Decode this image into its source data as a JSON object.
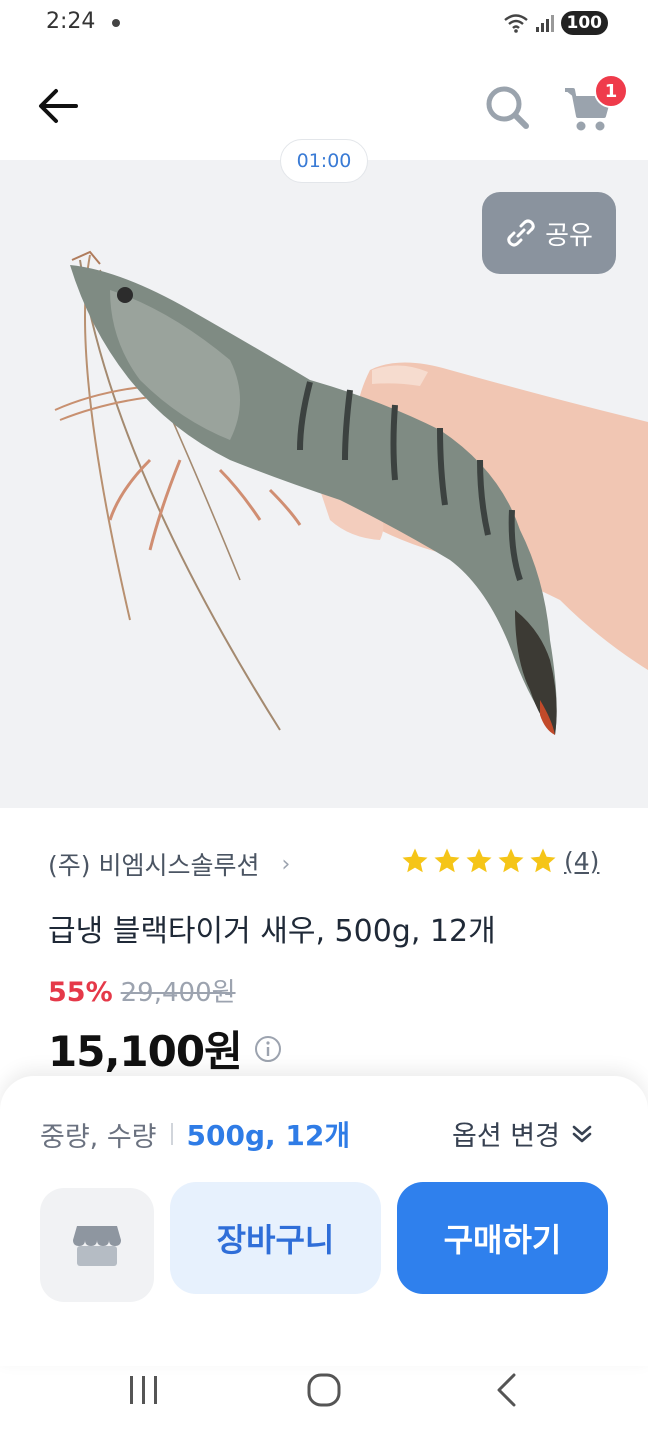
{
  "status": {
    "time": "2:24",
    "battery": "100"
  },
  "nav": {
    "cart_count": "1"
  },
  "media": {
    "timer": "01:00",
    "share_label": "공유"
  },
  "product": {
    "seller": "(주) 비엠시스솔루션",
    "rating_count": "(4)",
    "rating_stars": 5,
    "title": "급냉 블랙타이거 새우, 500g, 12개",
    "discount_rate": "55%",
    "original_price": "29,400원",
    "sale_price": "15,100원"
  },
  "options": {
    "label": "중량, 수량",
    "value": "500g, 12개",
    "change_label": "옵션 변경"
  },
  "actions": {
    "add_to_cart": "장바구니",
    "buy_now": "구매하기"
  },
  "colors": {
    "accent": "#2f80ed",
    "discount": "#e53949",
    "badge": "#ef3b4b",
    "star": "#f5c518"
  },
  "icons": {
    "back": "arrow-left-icon",
    "search": "search-icon",
    "cart": "cart-icon",
    "share": "link-icon",
    "store": "store-icon",
    "info": "info-icon",
    "chevron": "chevron-down-icon"
  }
}
